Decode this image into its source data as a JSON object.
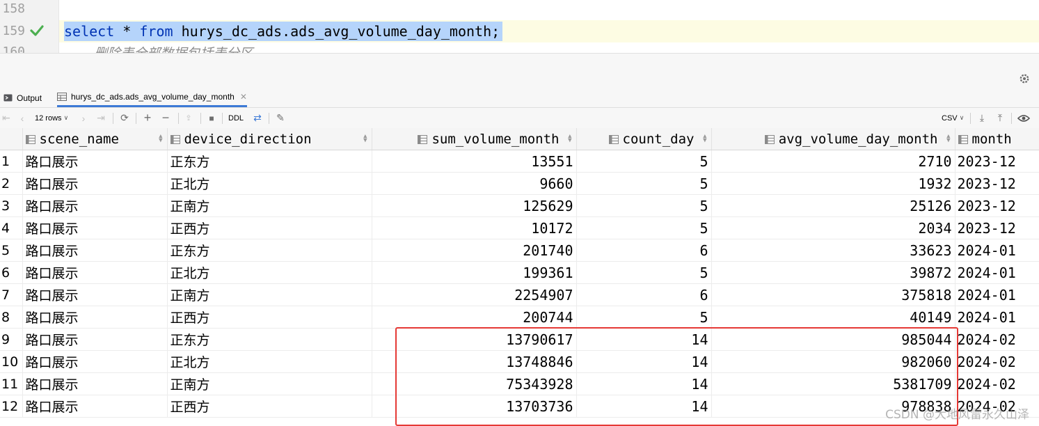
{
  "editor": {
    "lines": [
      {
        "number": "158"
      },
      {
        "number": "159",
        "sql_keyword1": "select",
        "sql_star": " * ",
        "sql_keyword2": "from",
        "sql_rest": " hurys_dc_ads.ads_avg_volume_day_month;"
      },
      {
        "number": "160",
        "comment": "-- 删除表全部数据包括表分区"
      }
    ]
  },
  "tabs": [
    {
      "label": "Output",
      "icon": "console-icon"
    },
    {
      "label": "hurys_dc_ads.ads_avg_volume_day_month",
      "icon": "table-icon"
    }
  ],
  "toolbar": {
    "rows_label": "12 rows",
    "ddl_label": "DDL",
    "csv_label": "CSV"
  },
  "grid": {
    "columns": [
      {
        "label": "scene_name"
      },
      {
        "label": "device_direction"
      },
      {
        "label": "sum_volume_month"
      },
      {
        "label": "count_day"
      },
      {
        "label": "avg_volume_day_month"
      },
      {
        "label": "month"
      }
    ],
    "rows": [
      {
        "n": "1",
        "scene": "路口展示",
        "dir": "正东方",
        "sum": "13551",
        "cnt": "5",
        "avg": "2710",
        "month": "2023-12"
      },
      {
        "n": "2",
        "scene": "路口展示",
        "dir": "正北方",
        "sum": "9660",
        "cnt": "5",
        "avg": "1932",
        "month": "2023-12"
      },
      {
        "n": "3",
        "scene": "路口展示",
        "dir": "正南方",
        "sum": "125629",
        "cnt": "5",
        "avg": "25126",
        "month": "2023-12"
      },
      {
        "n": "4",
        "scene": "路口展示",
        "dir": "正西方",
        "sum": "10172",
        "cnt": "5",
        "avg": "2034",
        "month": "2023-12"
      },
      {
        "n": "5",
        "scene": "路口展示",
        "dir": "正东方",
        "sum": "201740",
        "cnt": "6",
        "avg": "33623",
        "month": "2024-01"
      },
      {
        "n": "6",
        "scene": "路口展示",
        "dir": "正北方",
        "sum": "199361",
        "cnt": "5",
        "avg": "39872",
        "month": "2024-01"
      },
      {
        "n": "7",
        "scene": "路口展示",
        "dir": "正南方",
        "sum": "2254907",
        "cnt": "6",
        "avg": "375818",
        "month": "2024-01"
      },
      {
        "n": "8",
        "scene": "路口展示",
        "dir": "正西方",
        "sum": "200744",
        "cnt": "5",
        "avg": "40149",
        "month": "2024-01"
      },
      {
        "n": "9",
        "scene": "路口展示",
        "dir": "正东方",
        "sum": "13790617",
        "cnt": "14",
        "avg": "985044",
        "month": "2024-02"
      },
      {
        "n": "10",
        "scene": "路口展示",
        "dir": "正北方",
        "sum": "13748846",
        "cnt": "14",
        "avg": "982060",
        "month": "2024-02"
      },
      {
        "n": "11",
        "scene": "路口展示",
        "dir": "正南方",
        "sum": "75343928",
        "cnt": "14",
        "avg": "5381709",
        "month": "2024-02"
      },
      {
        "n": "12",
        "scene": "路口展示",
        "dir": "正西方",
        "sum": "13703736",
        "cnt": "14",
        "avg": "978838",
        "month": "2024-02"
      }
    ]
  },
  "watermark": "CSDN @大地风雷永久山泽",
  "colors": {
    "highlight_box": "#e53935",
    "selection": "#b5d4fb",
    "keyword": "#0033b3",
    "check": "#4caf50"
  }
}
